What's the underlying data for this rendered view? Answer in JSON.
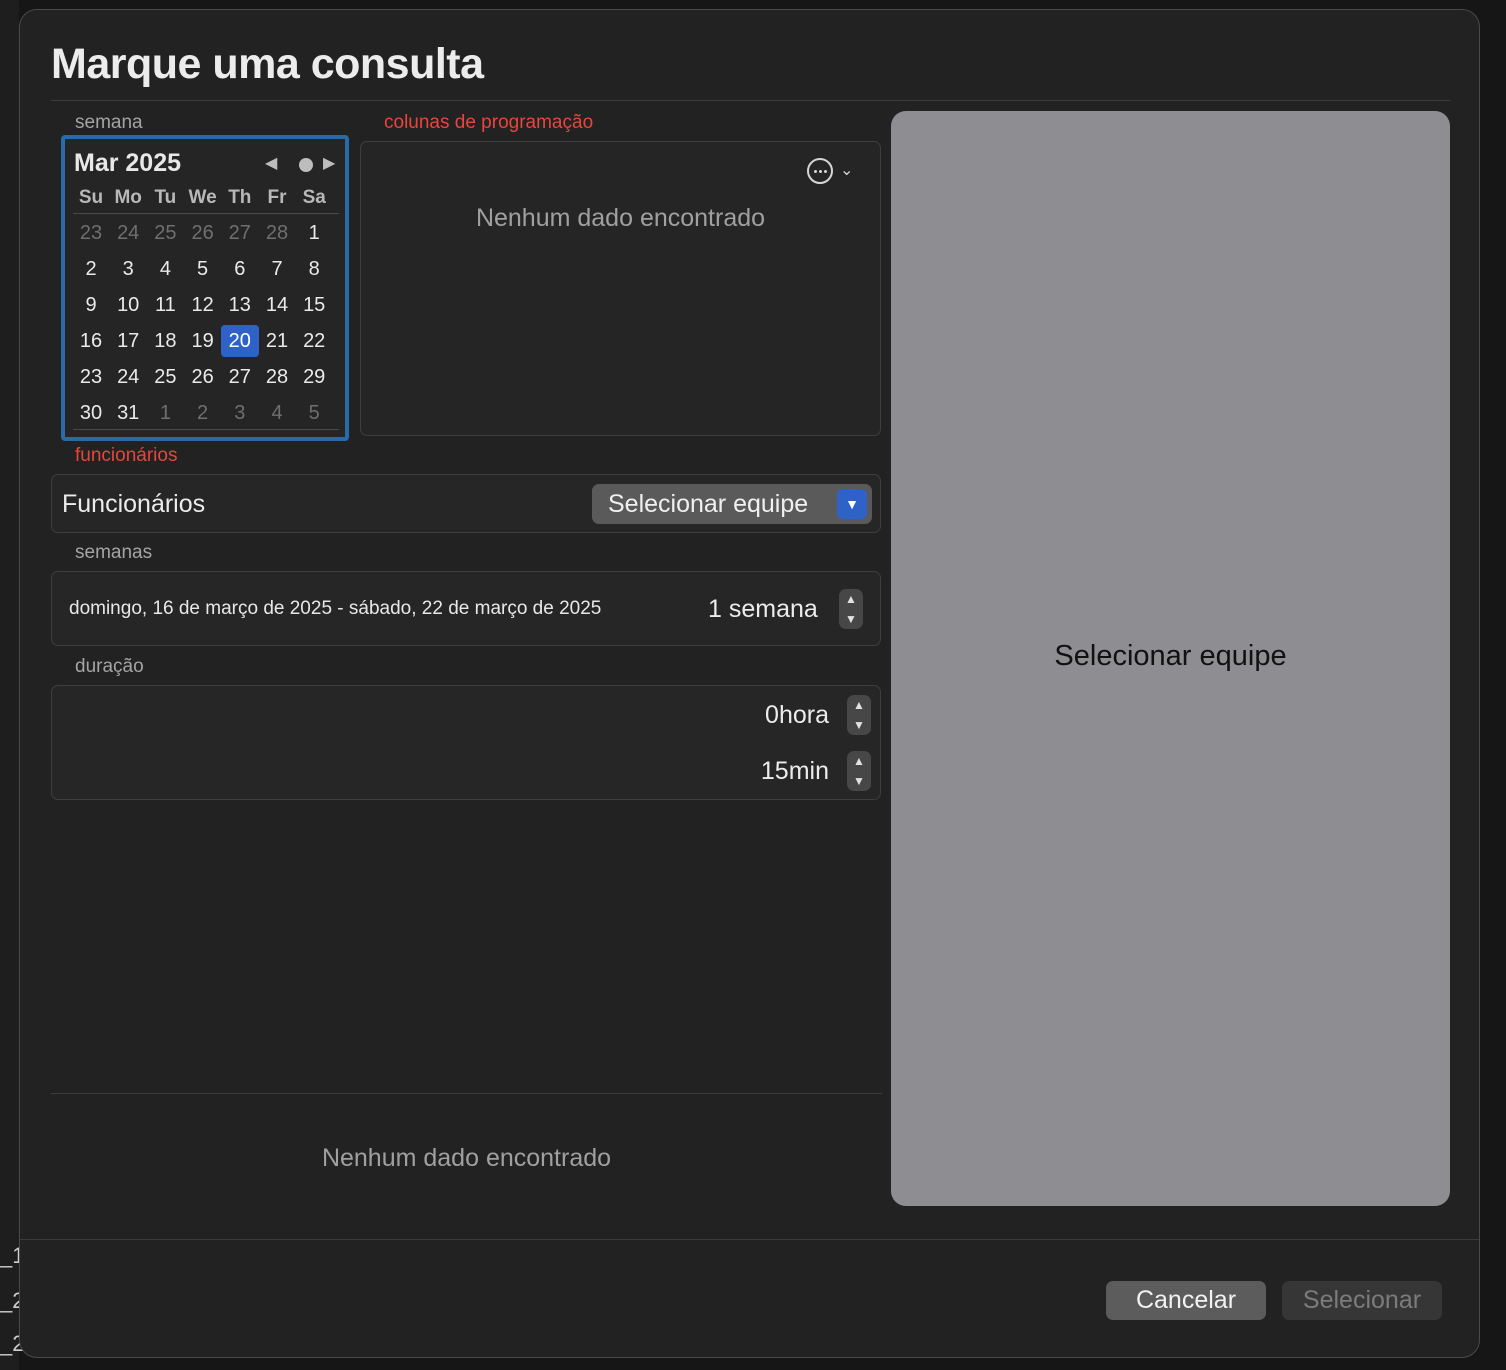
{
  "dialog": {
    "title": "Marque uma consulta"
  },
  "labels": {
    "week": "semana",
    "schedule_columns": "colunas de programação",
    "staff": "funcionários",
    "weeks": "semanas",
    "duration": "duração"
  },
  "calendar": {
    "month_label": "Mar 2025",
    "prev_icon": "triangle-left-icon",
    "today_icon": "dot-icon",
    "next_icon": "triangle-right-icon",
    "weekdays": [
      "Su",
      "Mo",
      "Tu",
      "We",
      "Th",
      "Fr",
      "Sa"
    ],
    "weeks": [
      [
        {
          "d": "23",
          "muted": true
        },
        {
          "d": "24",
          "muted": true
        },
        {
          "d": "25",
          "muted": true
        },
        {
          "d": "26",
          "muted": true
        },
        {
          "d": "27",
          "muted": true
        },
        {
          "d": "28",
          "muted": true
        },
        {
          "d": "1"
        }
      ],
      [
        {
          "d": "2"
        },
        {
          "d": "3"
        },
        {
          "d": "4"
        },
        {
          "d": "5"
        },
        {
          "d": "6"
        },
        {
          "d": "7"
        },
        {
          "d": "8"
        }
      ],
      [
        {
          "d": "9"
        },
        {
          "d": "10"
        },
        {
          "d": "11"
        },
        {
          "d": "12"
        },
        {
          "d": "13"
        },
        {
          "d": "14"
        },
        {
          "d": "15"
        }
      ],
      [
        {
          "d": "16"
        },
        {
          "d": "17"
        },
        {
          "d": "18"
        },
        {
          "d": "19"
        },
        {
          "d": "20",
          "selected": true
        },
        {
          "d": "21"
        },
        {
          "d": "22"
        }
      ],
      [
        {
          "d": "23"
        },
        {
          "d": "24"
        },
        {
          "d": "25"
        },
        {
          "d": "26"
        },
        {
          "d": "27"
        },
        {
          "d": "28"
        },
        {
          "d": "29"
        }
      ],
      [
        {
          "d": "30"
        },
        {
          "d": "31"
        },
        {
          "d": "1",
          "muted": true
        },
        {
          "d": "2",
          "muted": true
        },
        {
          "d": "3",
          "muted": true
        },
        {
          "d": "4",
          "muted": true
        },
        {
          "d": "5",
          "muted": true
        }
      ]
    ],
    "selected_color": "#2f62c9",
    "border_color": "#2b6aa8"
  },
  "schedule_columns": {
    "empty_text": "Nenhum dado encontrado",
    "menu_icon": "ellipsis-circle-icon",
    "menu_chevron_icon": "chevron-down-icon"
  },
  "staff": {
    "label": "Funcionários",
    "popup_value": "Selecionar equipe",
    "popup_icon": "chevron-down-icon"
  },
  "weeks": {
    "range_text": "domingo, 16 de março de 2025 - sábado, 22 de março de 2025",
    "value": "1 semana"
  },
  "duration": {
    "hours": "0hora",
    "minutes": "15min"
  },
  "results": {
    "empty_text": "Nenhum dado encontrado"
  },
  "preview": {
    "label": "Selecionar equipe",
    "background": "#8e8d92"
  },
  "buttons": {
    "cancel": "Cancelar",
    "select": "Selecionar"
  },
  "background_app": {
    "fragments": [
      "_1",
      "_2",
      "_2"
    ]
  }
}
